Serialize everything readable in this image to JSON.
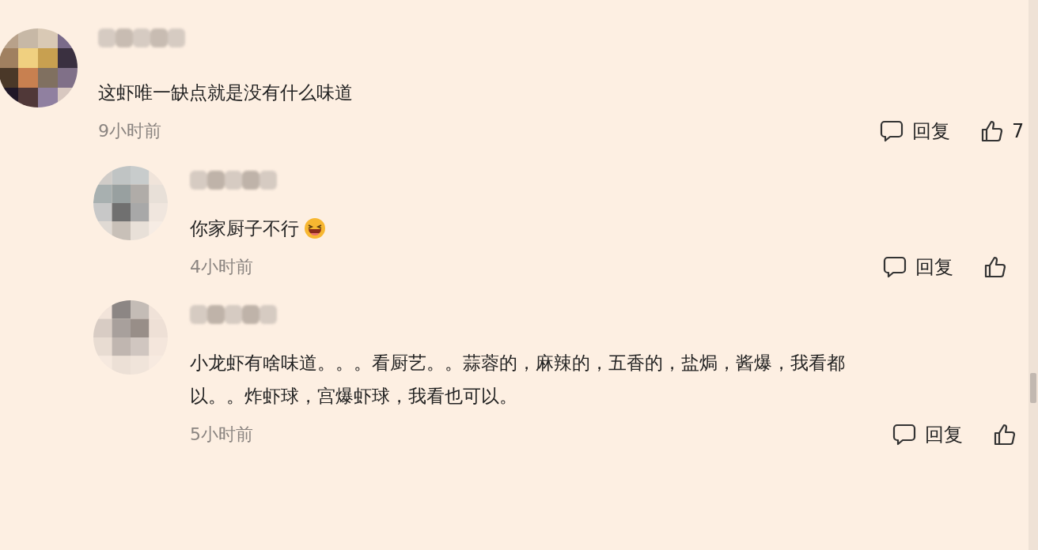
{
  "comments": [
    {
      "text_lines": [
        "这虾唯一缺点就是没有什么味道"
      ],
      "time": "9小时前",
      "reply_label": "回复",
      "like_count": "7",
      "children": [
        {
          "text_lines": [
            "你家厨子不行"
          ],
          "emoji": true,
          "time": "4小时前",
          "reply_label": "回复"
        },
        {
          "text_lines": [
            "小龙虾有啥味道。。。看厨艺。。蒜蓉的，麻辣的，五香的，盐焗，酱爆，我看都",
            "以。。炸虾球，宫爆虾球，我看也可以。"
          ],
          "time": "5小时前",
          "reply_label": "回复"
        }
      ]
    }
  ]
}
